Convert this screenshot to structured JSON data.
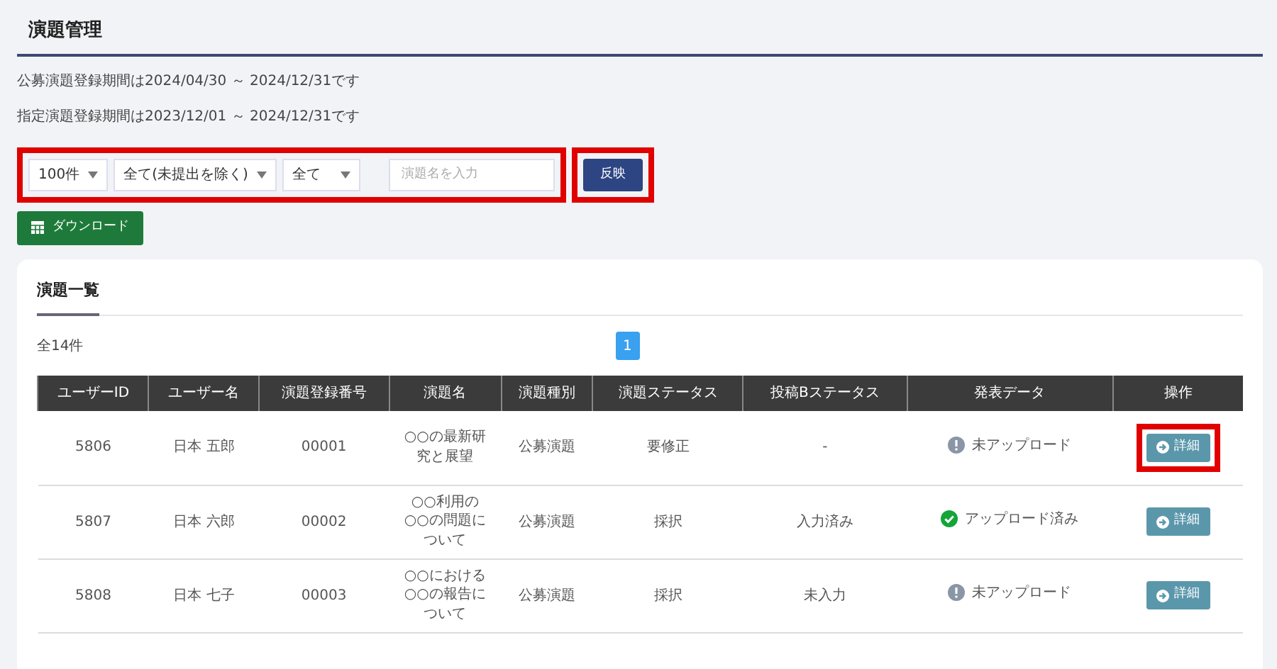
{
  "page_title": "演題管理",
  "notices": [
    "公募演題登録期間は2024/04/30 ～ 2024/12/31です",
    "指定演題登録期間は2023/12/01 ～ 2024/12/31です"
  ],
  "filters": {
    "selects": [
      {
        "value": "100件"
      },
      {
        "value": "全て(未提出を除く)"
      },
      {
        "value": "全て"
      }
    ],
    "search": {
      "placeholder": "演題名を入力"
    },
    "apply_button": "反映"
  },
  "download_button": "ダウンロード",
  "list_card": {
    "title": "演題一覧",
    "total": "全14件",
    "pages": [
      {
        "label": "1",
        "selected": true
      }
    ],
    "table": {
      "columns": [
        "ユーザーID",
        "ユーザー名",
        "演題登録番号",
        "演題名",
        "演題種別",
        "演題ステータス",
        "投稿Bステータス",
        "発表データ",
        "操作"
      ],
      "rows": [
        {
          "user_id": "5806",
          "user_name": "日本 五郎",
          "number": "00001",
          "title": "○○の最新研究と展望",
          "type": "公募演題",
          "status": "要修正",
          "b_status": "-",
          "data": {
            "kind": "missing",
            "text": "未アップロード"
          },
          "action": "詳細",
          "highlighted": true
        },
        {
          "user_id": "5807",
          "user_name": "日本 六郎",
          "number": "00002",
          "title": "○○利用の○○の問題について",
          "type": "公募演題",
          "status": "採択",
          "b_status": "入力済み",
          "data": {
            "kind": "uploaded",
            "text": "アップロード済み"
          },
          "action": "詳細",
          "highlighted": false
        },
        {
          "user_id": "5808",
          "user_name": "日本 七子",
          "number": "00003",
          "title": "○○における○○の報告について",
          "type": "公募演題",
          "status": "採択",
          "b_status": "未入力",
          "data": {
            "kind": "missing",
            "text": "未アップロード"
          },
          "action": "詳細",
          "highlighted": false
        }
      ]
    }
  }
}
